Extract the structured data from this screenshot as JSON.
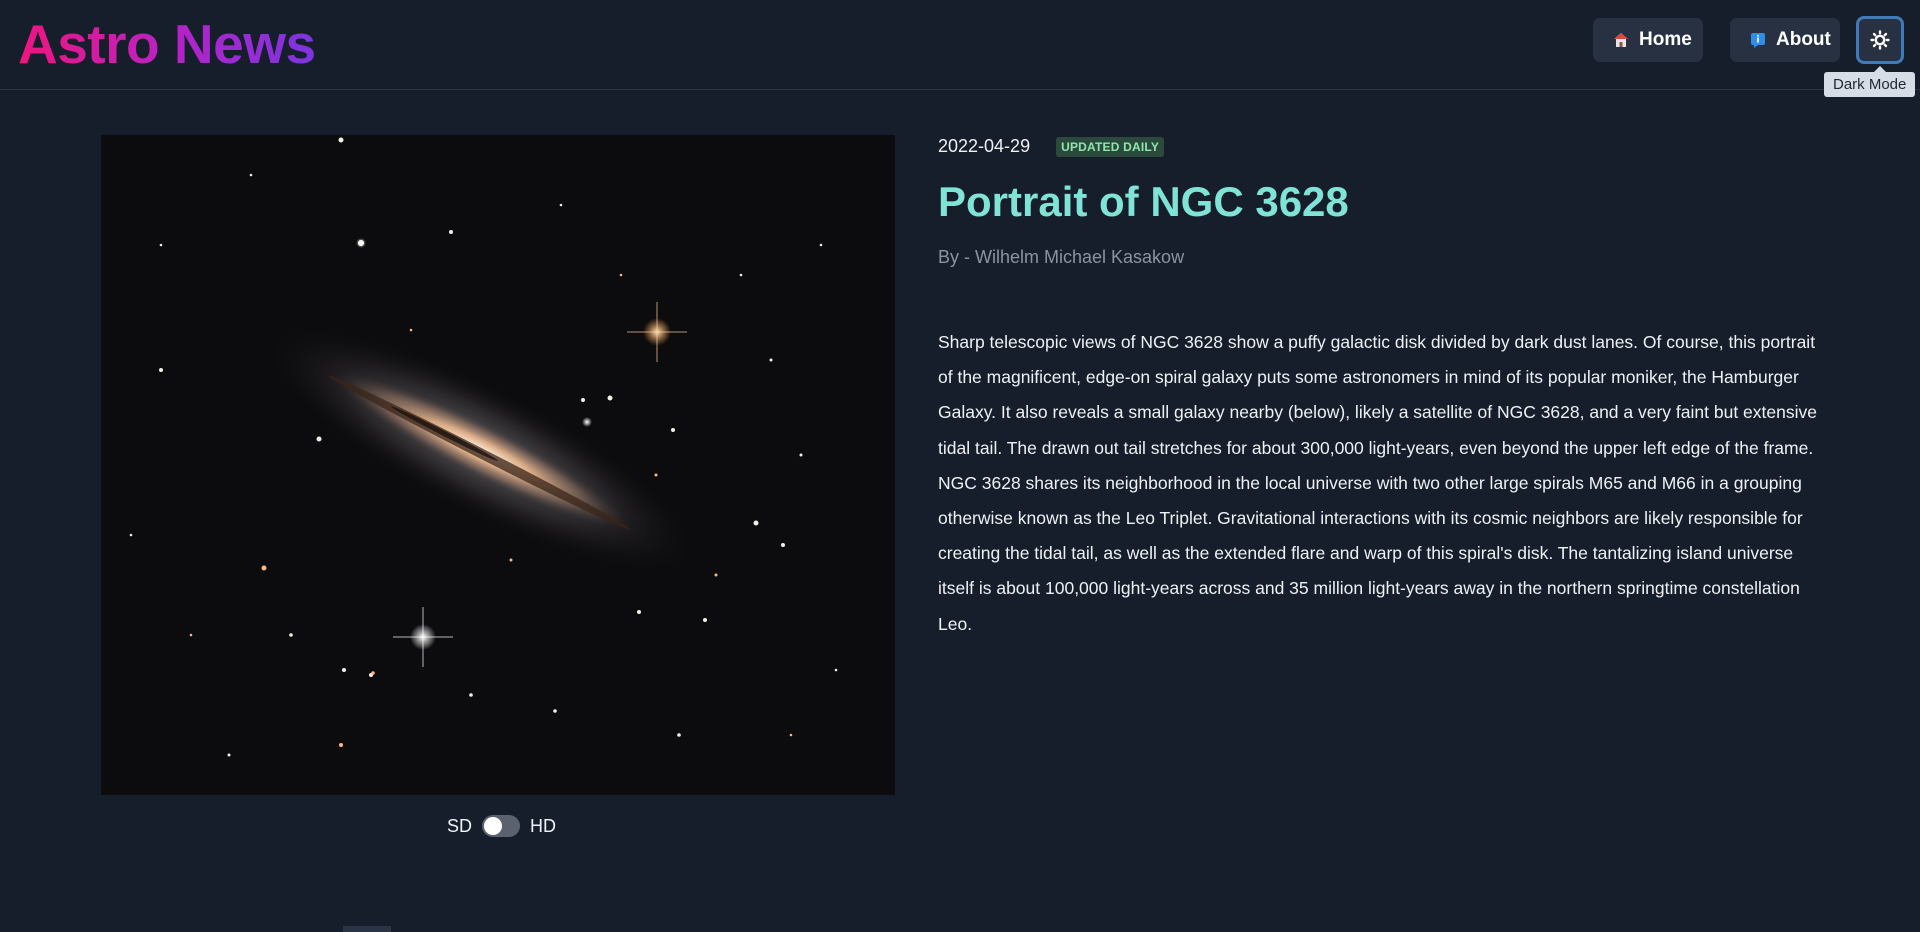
{
  "header": {
    "logo": "Astro News",
    "nav": [
      {
        "label": "Home",
        "icon": "house-icon"
      },
      {
        "label": "About",
        "icon": "info-icon"
      }
    ],
    "theme_toggle": {
      "icon": "sun-icon",
      "tooltip": "Dark Mode"
    }
  },
  "article": {
    "date": "2022-04-29",
    "badge": "UPDATED DAILY",
    "title": "Portrait of NGC 3628",
    "author": "By - Wilhelm Michael Kasakow",
    "description": "Sharp telescopic views of NGC 3628 show a puffy galactic disk divided by dark dust lanes. Of course, this portrait of the magnificent, edge-on spiral galaxy puts some astronomers in mind of its popular moniker, the Hamburger Galaxy. It also reveals a small galaxy nearby (below), likely a satellite of NGC 3628, and a very faint but extensive tidal tail. The drawn out tail stretches for about 300,000 light-years, even beyond the upper left edge of the frame. NGC 3628 shares its neighborhood in the local universe with two other large spirals M65 and M66 in a grouping otherwise known as the Leo Triplet. Gravitational interactions with its cosmic neighbors are likely responsible for creating the tidal tail, as well as the extended flare and warp of this spiral's disk. The tantalizing island universe itself is about 100,000 light-years across and 35 million light-years away in the northern springtime constellation Leo."
  },
  "quality_toggle": {
    "left_label": "SD",
    "right_label": "HD",
    "selected": "SD"
  },
  "colors": {
    "background": "#171e2b",
    "title": "#7fe3d6",
    "badge_text": "#8ee6ad",
    "logo_gradient_start": "#f0157f",
    "logo_gradient_end": "#7a35e0"
  }
}
